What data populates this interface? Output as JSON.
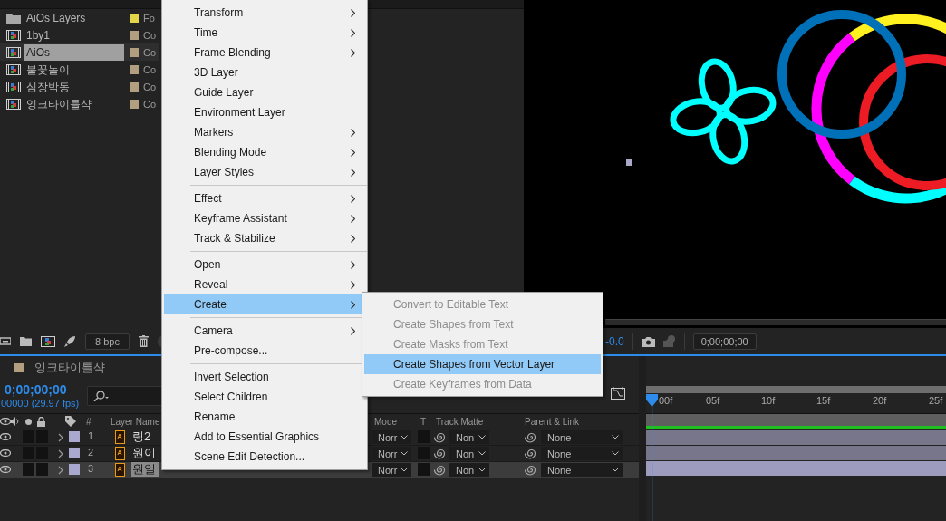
{
  "project": {
    "items": [
      {
        "name": "AiOs Layers",
        "kind": "folder",
        "color": "#e2d548",
        "type": "Fo",
        "selected": false
      },
      {
        "name": "1by1",
        "kind": "composition",
        "color": "#b19f7f",
        "type": "Co",
        "selected": false
      },
      {
        "name": "AiOs",
        "kind": "composition",
        "color": "#b19f7f",
        "type": "Co",
        "selected": true
      },
      {
        "name": "불꽃놀이",
        "kind": "composition",
        "color": "#b19f7f",
        "type": "Co",
        "selected": false
      },
      {
        "name": "심장박동",
        "kind": "composition",
        "color": "#b19f7f",
        "type": "Co",
        "selected": false
      },
      {
        "name": "잉크타이틀샥",
        "kind": "composition",
        "color": "#b19f7f",
        "type": "Co",
        "selected": false
      }
    ],
    "bit_depth": "8 bpc"
  },
  "viewer": {
    "exposure": "-0.0",
    "timecode": "0;00;00;00"
  },
  "timeline": {
    "tab": {
      "name": "잉크타이틀샥",
      "color": "#b19f7f"
    },
    "timecode": "0;00;00;00",
    "fps": "00000 (29.97 fps)",
    "columns": {
      "number": "#",
      "layer_name": "Layer Name",
      "mode": "Mode",
      "t": "T",
      "track_matte": "Track Matte",
      "parent": "Parent & Link"
    },
    "layers": [
      {
        "number": "1",
        "name": "링2",
        "color": "#a9a9cf",
        "mode": "Norr",
        "track_matte": "Non",
        "parent": "None",
        "selected": false
      },
      {
        "number": "2",
        "name": "원이",
        "color": "#a9a9cf",
        "mode": "Norr",
        "track_matte": "Non",
        "parent": "None",
        "selected": false
      },
      {
        "number": "3",
        "name": "원일",
        "color": "#a9a9cf",
        "mode": "Norr",
        "track_matte": "Non",
        "parent": "None",
        "selected": true
      }
    ],
    "ruler": [
      "00f",
      "05f",
      "10f",
      "15f",
      "20f",
      "25f"
    ]
  },
  "context_menu": {
    "items": [
      {
        "kind": "item",
        "label": "Transform",
        "submenu": true,
        "selected": false
      },
      {
        "kind": "item",
        "label": "Time",
        "submenu": true,
        "selected": false
      },
      {
        "kind": "item",
        "label": "Frame Blending",
        "submenu": true,
        "selected": false
      },
      {
        "kind": "item",
        "label": "3D Layer",
        "submenu": false,
        "selected": false
      },
      {
        "kind": "item",
        "label": "Guide Layer",
        "submenu": false,
        "selected": false
      },
      {
        "kind": "item",
        "label": "Environment Layer",
        "submenu": false,
        "selected": false
      },
      {
        "kind": "item",
        "label": "Markers",
        "submenu": true,
        "selected": false
      },
      {
        "kind": "item",
        "label": "Blending Mode",
        "submenu": true,
        "selected": false
      },
      {
        "kind": "item",
        "label": "Layer Styles",
        "submenu": true,
        "selected": false
      },
      {
        "kind": "separator"
      },
      {
        "kind": "item",
        "label": "Effect",
        "submenu": true,
        "selected": false
      },
      {
        "kind": "item",
        "label": "Keyframe Assistant",
        "submenu": true,
        "selected": false
      },
      {
        "kind": "item",
        "label": "Track & Stabilize",
        "submenu": true,
        "selected": false
      },
      {
        "kind": "separator"
      },
      {
        "kind": "item",
        "label": "Open",
        "submenu": true,
        "selected": false
      },
      {
        "kind": "item",
        "label": "Reveal",
        "submenu": true,
        "selected": false
      },
      {
        "kind": "item",
        "label": "Create",
        "submenu": true,
        "selected": true
      },
      {
        "kind": "separator"
      },
      {
        "kind": "item",
        "label": "Camera",
        "submenu": true,
        "selected": false
      },
      {
        "kind": "item",
        "label": "Pre-compose...",
        "submenu": false,
        "selected": false
      },
      {
        "kind": "separator"
      },
      {
        "kind": "item",
        "label": "Invert Selection",
        "submenu": false,
        "selected": false
      },
      {
        "kind": "item",
        "label": "Select Children",
        "submenu": false,
        "selected": false
      },
      {
        "kind": "item",
        "label": "Rename",
        "submenu": false,
        "selected": false
      },
      {
        "kind": "item",
        "label": "Add to Essential Graphics",
        "submenu": false,
        "selected": false
      },
      {
        "kind": "item",
        "label": "Scene Edit Detection...",
        "submenu": false,
        "selected": false
      }
    ]
  },
  "submenu": {
    "items": [
      {
        "label": "Convert to Editable Text",
        "disabled": true,
        "selected": false
      },
      {
        "label": "Create Shapes from Text",
        "disabled": true,
        "selected": false
      },
      {
        "label": "Create Masks from Text",
        "disabled": true,
        "selected": false
      },
      {
        "label": "Create Shapes from Vector Layer",
        "disabled": false,
        "selected": true
      },
      {
        "label": "Create Keyframes from Data",
        "disabled": true,
        "selected": false
      }
    ]
  }
}
